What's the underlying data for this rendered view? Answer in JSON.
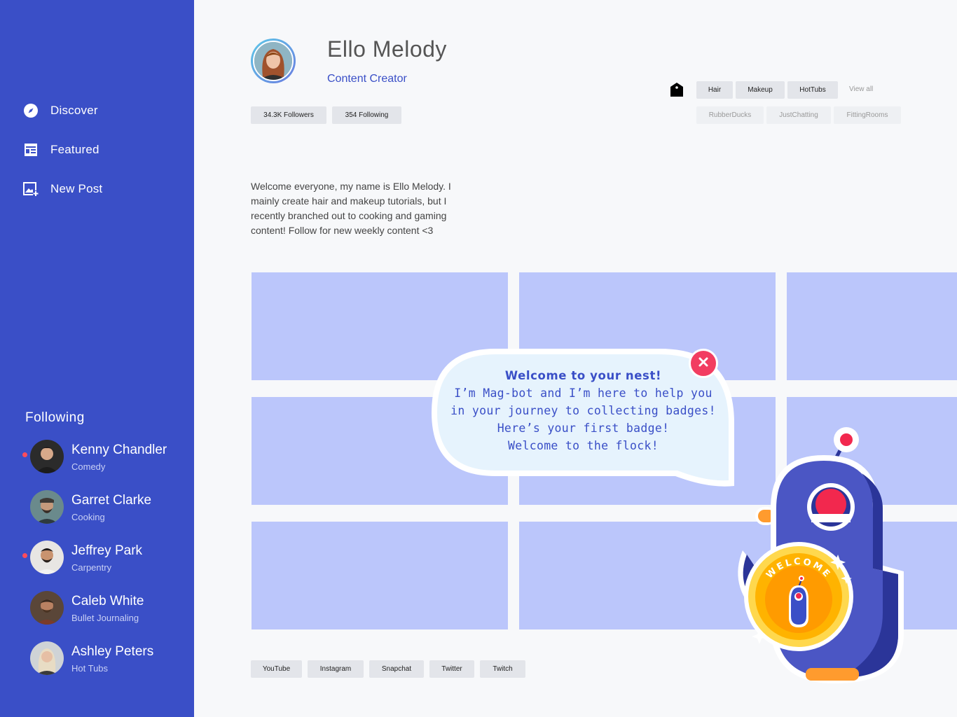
{
  "sidebar": {
    "nav": [
      {
        "label": "Discover",
        "icon": "compass-icon"
      },
      {
        "label": "Featured",
        "icon": "featured-icon"
      },
      {
        "label": "New Post",
        "icon": "add-photo-icon"
      }
    ],
    "following_title": "Following",
    "following": [
      {
        "name": "Kenny Chandler",
        "category": "Comedy",
        "online": true
      },
      {
        "name": "Garret Clarke",
        "category": "Cooking",
        "online": false
      },
      {
        "name": "Jeffrey Park",
        "category": "Carpentry",
        "online": true
      },
      {
        "name": "Caleb White",
        "category": "Bullet Journaling",
        "online": false
      },
      {
        "name": "Ashley Peters",
        "category": "Hot Tubs",
        "online": false
      }
    ]
  },
  "profile": {
    "name": "Ello Melody",
    "role": "Content Creator",
    "followers": "34.3K Followers",
    "following": "354 Following",
    "bio": "Welcome everyone, my name is Ello Melody. I mainly create hair and makeup tutorials, but I recently branched out to cooking and gaming content! Follow for new weekly content <3"
  },
  "tags": {
    "primary": [
      "Hair",
      "Makeup",
      "HotTubs"
    ],
    "view_all": "View all",
    "secondary": [
      "RubberDucks",
      "JustChatting",
      "FittingRooms"
    ]
  },
  "social": [
    "YouTube",
    "Instagram",
    "Snapchat",
    "Twitter",
    "Twitch"
  ],
  "bubble": {
    "title": "Welcome to your nest!",
    "line1": "I’m Mag-bot and I’m here to help you",
    "line2": "in your journey to collecting badges!",
    "line3": "Here’s your first badge!",
    "line4": "Welcome to the flock!"
  },
  "badge": {
    "text": "WELCOME"
  },
  "colors": {
    "sidebar": "#3a4fc7",
    "tile": "#bbc6fb",
    "accent": "#3a4fc7",
    "notification": "#ff4b5c",
    "close": "#f23d61",
    "badge": "#ffb300"
  }
}
